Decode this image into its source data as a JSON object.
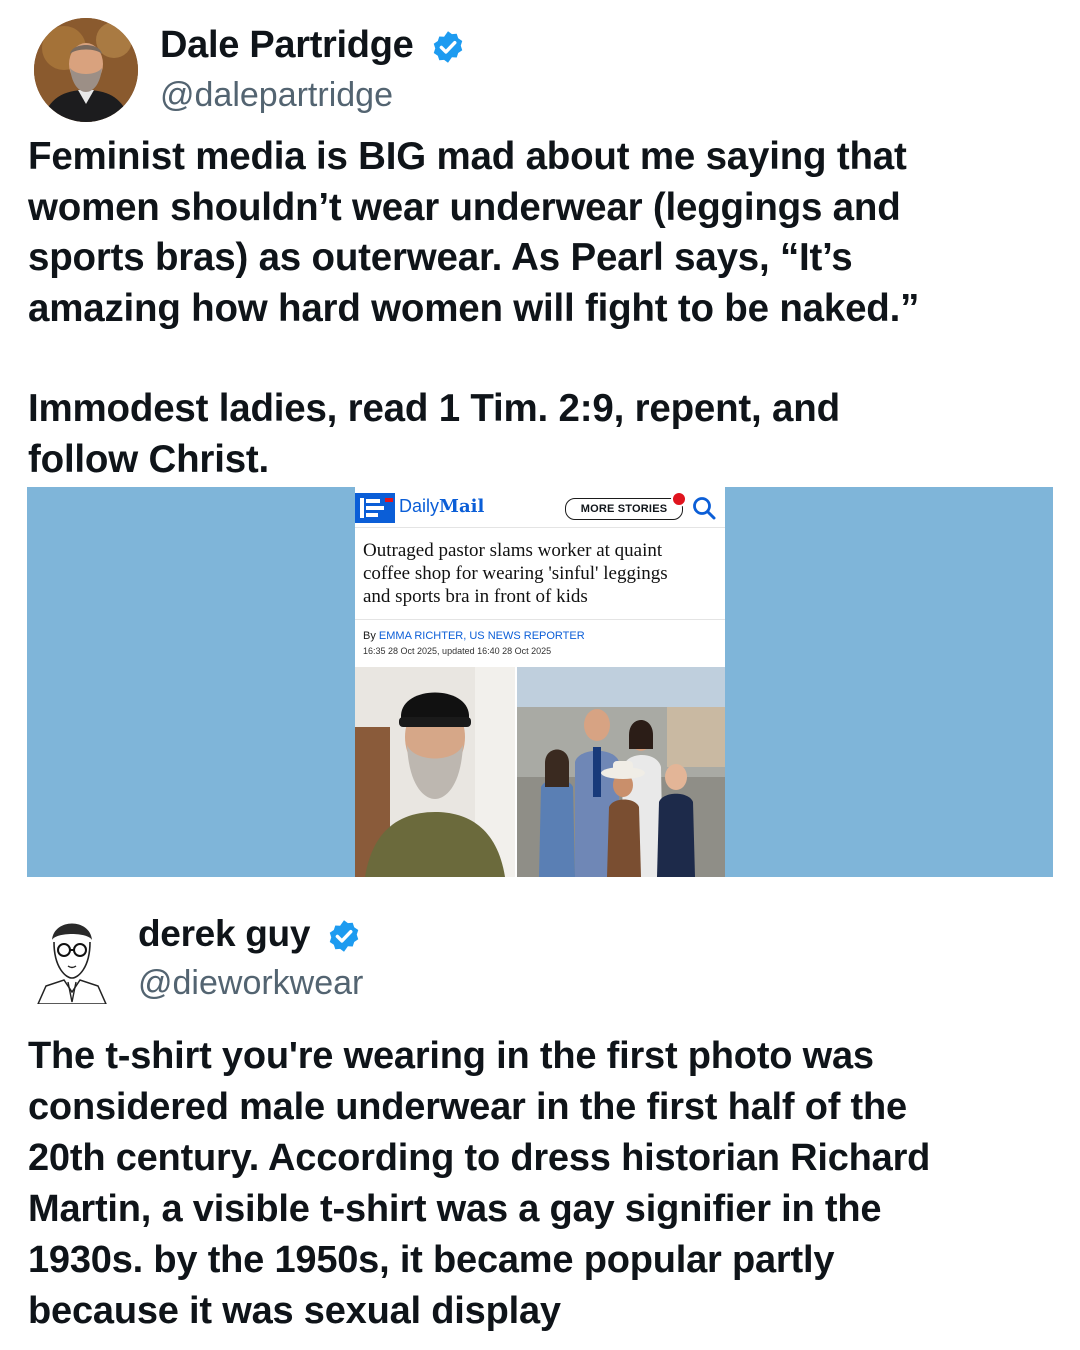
{
  "post1": {
    "author": {
      "name": "Dale Partridge",
      "handle": "@dalepartridge",
      "verified": true,
      "avatar_icon": "profile-photo"
    },
    "lines": [
      "Feminist media is BIG mad about me saying that",
      "women shouldn’t wear underwear (leggings and",
      "sports bras) as outerwear. As Pearl says, “It’s",
      "amazing how hard women will fight to be naked.”",
      "Immodest ladies, read 1 Tim. 2:9, repent, and",
      "follow Christ."
    ]
  },
  "article": {
    "site": "Daily",
    "site_bold": "Mail",
    "more_stories": "MORE STORIES",
    "headline_lines": [
      "Outraged pastor slams worker at quaint",
      "coffee shop for wearing 'sinful' leggings",
      "and sports bra in front of kids"
    ],
    "byline_prefix": "By ",
    "byline_author": "EMMA RICHTER, US NEWS REPORTER",
    "dateline": "16:35 28 Oct 2025, updated 16:40 28 Oct 2025",
    "brand_color": "#0b5ed7",
    "backdrop_color": "#7fb5d9"
  },
  "post2": {
    "author": {
      "name": "derek guy",
      "handle": "@dieworkwear",
      "verified": true,
      "avatar_icon": "sketch-portrait"
    },
    "lines": [
      "The t-shirt you're wearing in the first photo was",
      "considered male underwear in the first half of the",
      "20th century. According to dress historian Richard",
      "Martin, a visible t-shirt was a gay signifier in the",
      "1930s. by the 1950s, it became popular partly",
      "because it was sexual display"
    ]
  },
  "colors": {
    "verified_blue": "#1d9bf0",
    "text": "#0f1419",
    "secondary": "#536471"
  }
}
